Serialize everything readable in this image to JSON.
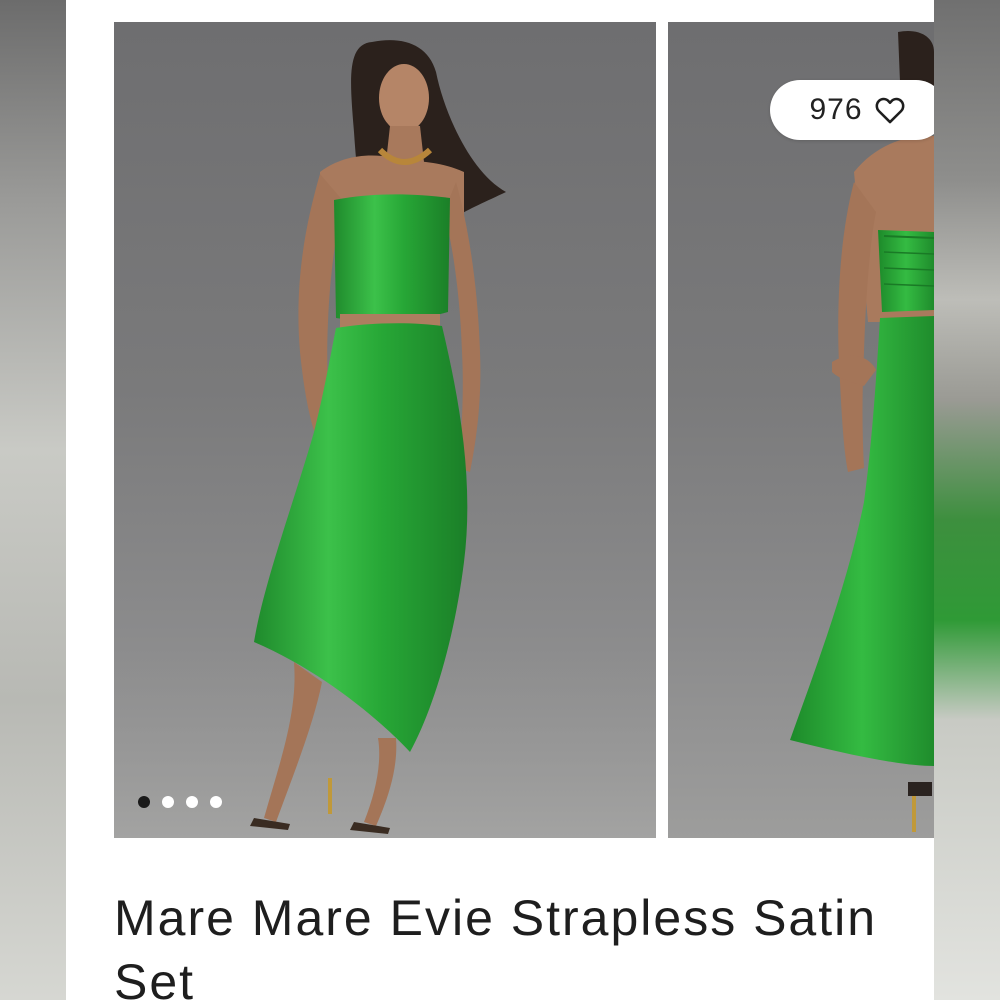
{
  "product": {
    "title": "Mare Mare Evie Strapless Satin Set",
    "likes": "976"
  },
  "gallery": {
    "slide_count": 4,
    "active_slide": 1,
    "images": [
      {
        "name": "front view"
      },
      {
        "name": "back view"
      }
    ]
  },
  "colors": {
    "satin_green": "#2fae3c",
    "backdrop_gray": "#7b7b7c",
    "text": "#1e1e1e"
  },
  "icons": {
    "like": "heart-outline-icon"
  }
}
